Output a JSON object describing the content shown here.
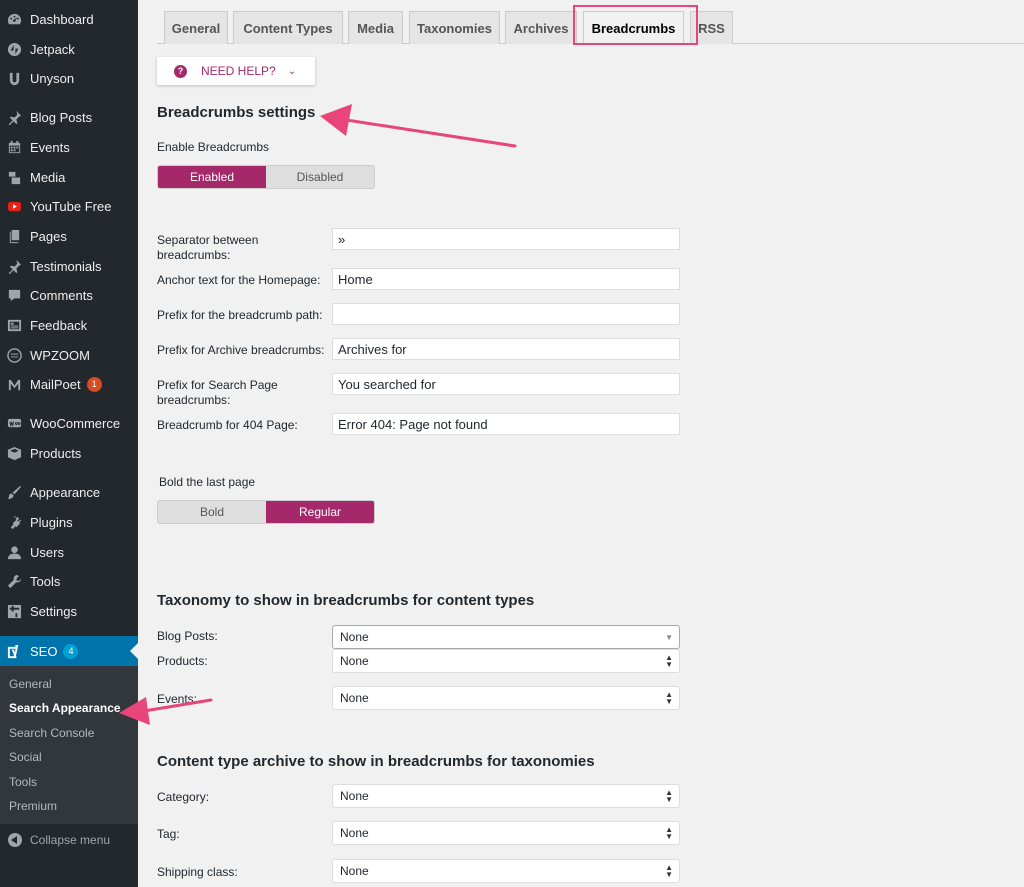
{
  "colors": {
    "sidebar": "#23282d",
    "active_menu": "#0073aa",
    "accent": "#a4286a",
    "annotation": "#e8457a"
  },
  "sidebar": {
    "items": [
      {
        "label": "Dashboard",
        "icon": "dashboard-icon"
      },
      {
        "label": "Jetpack",
        "icon": "jetpack-icon"
      },
      {
        "label": "Unyson",
        "icon": "unyson-icon"
      },
      {
        "label": "Blog Posts",
        "icon": "pin-icon"
      },
      {
        "label": "Events",
        "icon": "calendar-icon"
      },
      {
        "label": "Media",
        "icon": "media-icon"
      },
      {
        "label": "YouTube Free",
        "icon": "youtube-icon"
      },
      {
        "label": "Pages",
        "icon": "pages-icon"
      },
      {
        "label": "Testimonials",
        "icon": "pin-icon"
      },
      {
        "label": "Comments",
        "icon": "comment-icon"
      },
      {
        "label": "Feedback",
        "icon": "feedback-icon"
      },
      {
        "label": "WPZOOM",
        "icon": "wpzoom-icon"
      },
      {
        "label": "MailPoet",
        "icon": "mailpoet-icon",
        "badge": "1"
      },
      {
        "label": "WooCommerce",
        "icon": "woo-icon"
      },
      {
        "label": "Products",
        "icon": "box-icon"
      },
      {
        "label": "Appearance",
        "icon": "brush-icon"
      },
      {
        "label": "Plugins",
        "icon": "plugin-icon"
      },
      {
        "label": "Users",
        "icon": "user-icon"
      },
      {
        "label": "Tools",
        "icon": "wrench-icon"
      },
      {
        "label": "Settings",
        "icon": "settings-icon"
      }
    ],
    "seo": {
      "label": "SEO",
      "badge": "4",
      "icon": "yoast-icon"
    },
    "submenu": [
      "General",
      "Search Appearance",
      "Search Console",
      "Social",
      "Tools",
      "Premium"
    ],
    "collapse_label": "Collapse menu"
  },
  "tabs": [
    "General",
    "Content Types",
    "Media",
    "Taxonomies",
    "Archives",
    "Breadcrumbs",
    "RSS"
  ],
  "help_button": "NEED HELP?",
  "breadcrumbs": {
    "heading": "Breadcrumbs settings",
    "enable_label": "Enable Breadcrumbs",
    "enable_options": [
      "Enabled",
      "Disabled"
    ],
    "fields": [
      {
        "label": "Separator between breadcrumbs:",
        "value": "»"
      },
      {
        "label": "Anchor text for the Homepage:",
        "value": "Home"
      },
      {
        "label": "Prefix for the breadcrumb path:",
        "value": ""
      },
      {
        "label": "Prefix for Archive breadcrumbs:",
        "value": "Archives for"
      },
      {
        "label": "Prefix for Search Page breadcrumbs:",
        "value": "You searched for"
      },
      {
        "label": "Breadcrumb for 404 Page:",
        "value": "Error 404: Page not found"
      }
    ],
    "bold_label": "Bold the last page",
    "bold_options": [
      "Bold",
      "Regular"
    ]
  },
  "taxonomy_section": {
    "heading": "Taxonomy to show in breadcrumbs for content types",
    "rows": [
      {
        "label": "Blog Posts:",
        "value": "None"
      },
      {
        "label": "Products:",
        "value": "None"
      },
      {
        "label": "Events:",
        "value": "None"
      }
    ]
  },
  "archive_section": {
    "heading": "Content type archive to show in breadcrumbs for taxonomies",
    "rows": [
      {
        "label": "Category:",
        "value": "None"
      },
      {
        "label": "Tag:",
        "value": "None"
      },
      {
        "label": "Shipping class:",
        "value": "None"
      }
    ]
  }
}
